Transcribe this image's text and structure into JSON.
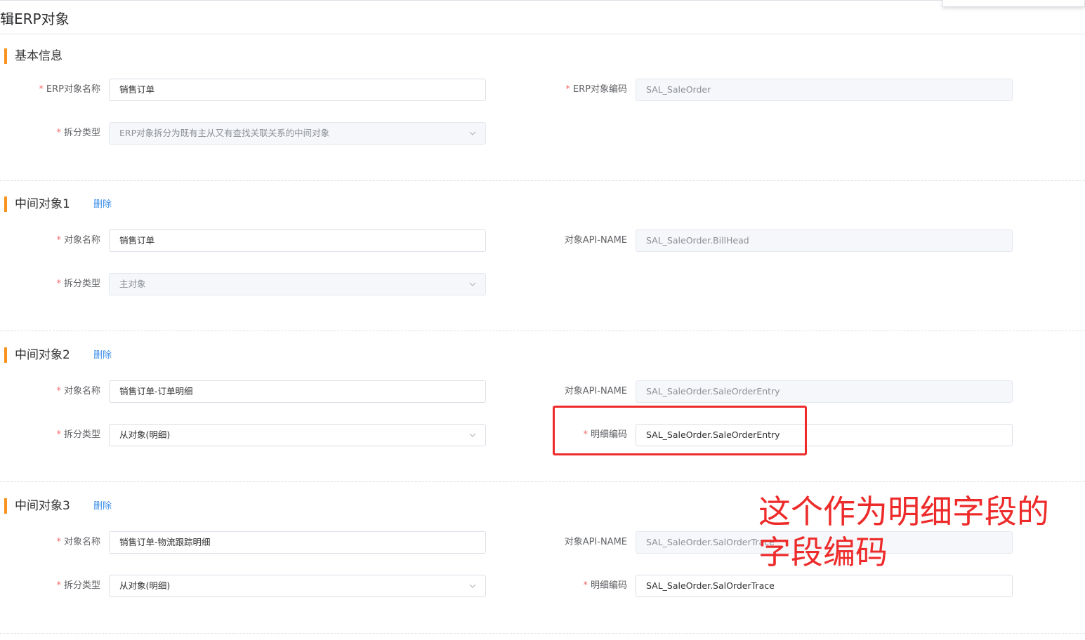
{
  "page_title": "辑ERP对象",
  "basic": {
    "title": "基本信息",
    "name_label": "ERP对象名称",
    "name_value": "销售订单",
    "code_label": "ERP对象编码",
    "code_value": "SAL_SaleOrder",
    "split_label": "拆分类型",
    "split_value": "ERP对象拆分为既有主从又有查找关联关系的中间对象"
  },
  "mid1": {
    "title": "中间对象1",
    "delete_label": "删除",
    "name_label": "对象名称",
    "name_value": "销售订单",
    "api_label": "对象API-NAME",
    "api_value": "SAL_SaleOrder.BillHead",
    "split_label": "拆分类型",
    "split_value": "主对象"
  },
  "mid2": {
    "title": "中间对象2",
    "delete_label": "删除",
    "name_label": "对象名称",
    "name_value": "销售订单-订单明细",
    "api_label": "对象API-NAME",
    "api_value": "SAL_SaleOrder.SaleOrderEntry",
    "split_label": "拆分类型",
    "split_value": "从对象(明细)",
    "detail_label": "明细编码",
    "detail_value": "SAL_SaleOrder.SaleOrderEntry"
  },
  "mid3": {
    "title": "中间对象3",
    "delete_label": "删除",
    "name_label": "对象名称",
    "name_value": "销售订单-物流跟踪明细",
    "api_label": "对象API-NAME",
    "api_value": "SAL_SaleOrder.SalOrderTrace",
    "split_label": "拆分类型",
    "split_value": "从对象(明细)",
    "detail_label": "明细编码",
    "detail_value": "SAL_SaleOrder.SalOrderTrace"
  },
  "required_mark": "*",
  "annotation": "这个作为明细字段的字段编码",
  "colors": {
    "accent_bar": "#f7931e",
    "link": "#3b8ee8",
    "required": "#f56c6c",
    "annotation": "#ee2b2b"
  }
}
